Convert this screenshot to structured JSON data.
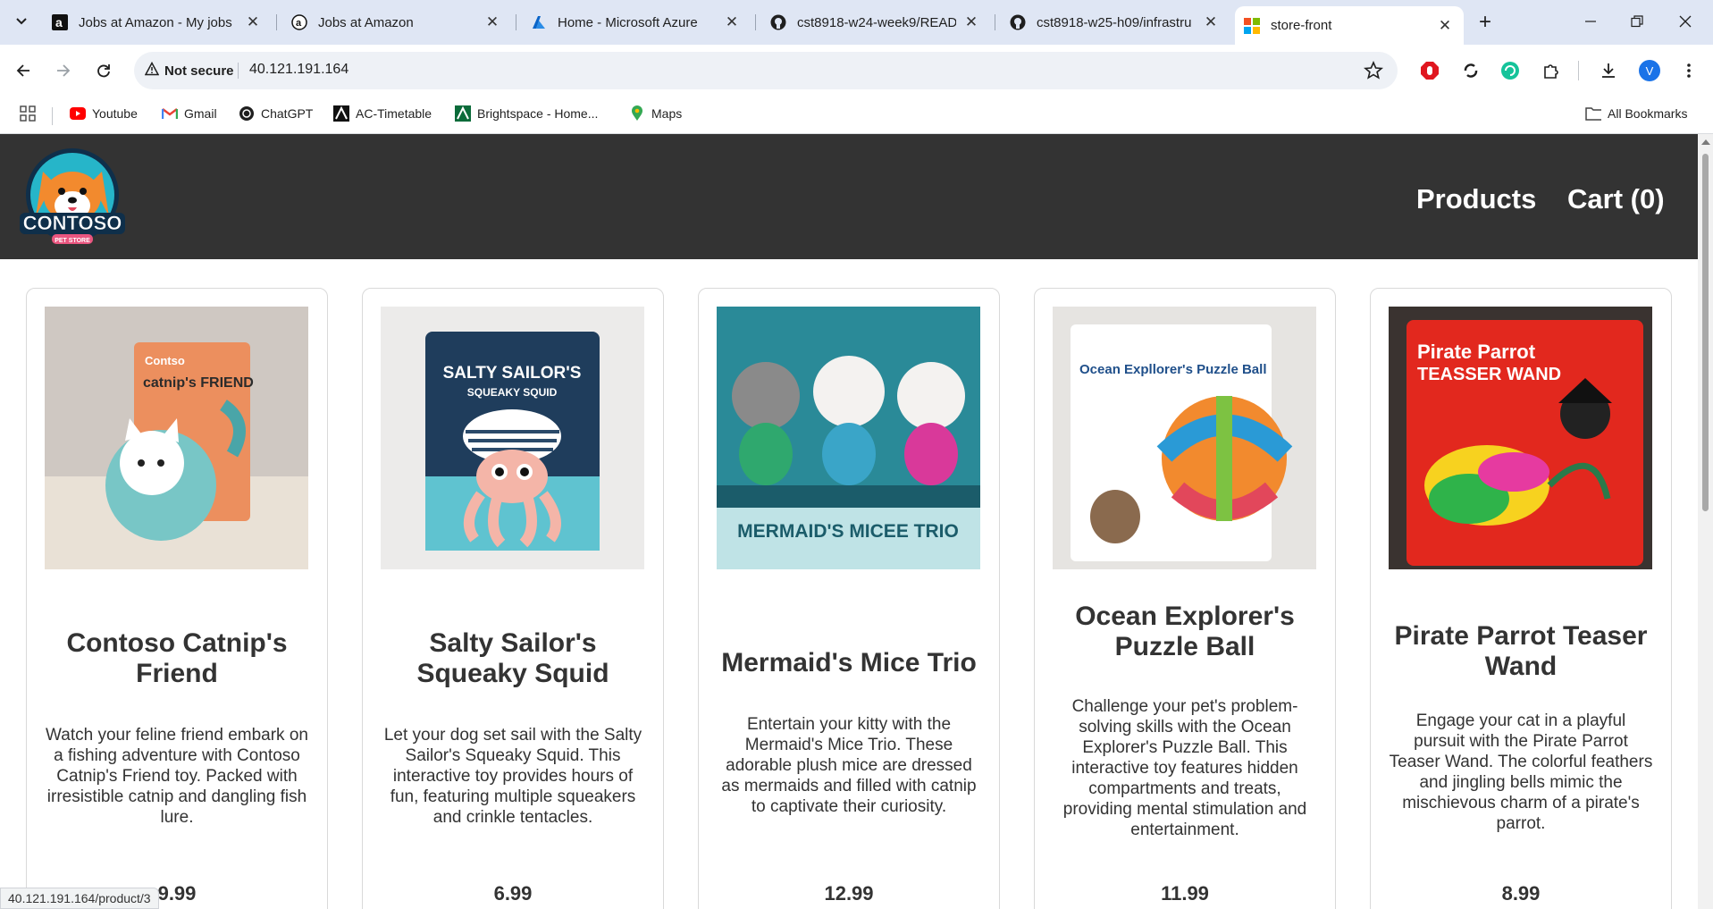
{
  "browser": {
    "tabs": [
      {
        "title": "Jobs at Amazon - My jobs",
        "icon": "amazon-icon"
      },
      {
        "title": "Jobs at Amazon",
        "icon": "amazon-jobs-icon"
      },
      {
        "title": "Home - Microsoft Azure",
        "icon": "azure-icon"
      },
      {
        "title": "cst8918-w24-week9/READ",
        "icon": "github-icon"
      },
      {
        "title": "cst8918-w25-h09/infrastru",
        "icon": "github-icon"
      },
      {
        "title": "store-front",
        "icon": "windows-logo-icon",
        "active": true
      }
    ],
    "security_label": "Not secure",
    "url": "40.121.191.164",
    "profile_initial": "V",
    "bookmarks": [
      {
        "label": "Youtube",
        "icon": "youtube-icon"
      },
      {
        "label": "Gmail",
        "icon": "gmail-icon"
      },
      {
        "label": "ChatGPT",
        "icon": "chatgpt-icon"
      },
      {
        "label": "AC-Timetable",
        "icon": "ac-icon"
      },
      {
        "label": "Brightspace - Home...",
        "icon": "brightspace-icon"
      },
      {
        "label": "Maps",
        "icon": "maps-pin-icon"
      }
    ],
    "all_bookmarks_label": "All Bookmarks",
    "status_url": "40.121.191.164/product/3"
  },
  "site": {
    "logo_text": "CONTOSO",
    "logo_subtext": "PET STORE",
    "nav": {
      "products": "Products",
      "cart": "Cart (0)"
    },
    "header_color": "#333333"
  },
  "products": [
    {
      "name": "Contoso Catnip's Friend",
      "description": "Watch your feline friend embark on a fishing adventure with Contoso Catnip's Friend toy. Packed with irresistible catnip and dangling fish lure.",
      "price": "9.99",
      "image": "catnip-friend-toy-image"
    },
    {
      "name": "Salty Sailor's Squeaky Squid",
      "description": "Let your dog set sail with the Salty Sailor's Squeaky Squid. This interactive toy provides hours of fun, featuring multiple squeakers and crinkle tentacles.",
      "price": "6.99",
      "image": "squeaky-squid-toy-image"
    },
    {
      "name": "Mermaid's Mice Trio",
      "description": "Entertain your kitty with the Mermaid's Mice Trio. These adorable plush mice are dressed as mermaids and filled with catnip to captivate their curiosity.",
      "price": "12.99",
      "image": "mermaid-mice-toy-image"
    },
    {
      "name": "Ocean Explorer's Puzzle Ball",
      "description": "Challenge your pet's problem-solving skills with the Ocean Explorer's Puzzle Ball. This interactive toy features hidden compartments and treats, providing mental stimulation and entertainment.",
      "price": "11.99",
      "image": "puzzle-ball-toy-image"
    },
    {
      "name": "Pirate Parrot Teaser Wand",
      "description": "Engage your cat in a playful pursuit with the Pirate Parrot Teaser Wand. The colorful feathers and jingling bells mimic the mischievous charm of a pirate's parrot.",
      "price": "8.99",
      "image": "teaser-wand-toy-image"
    }
  ],
  "product_image_text": {
    "p1_brand": "Contso",
    "p1_title": "catnip's FRIEND",
    "p2_title": "SALTY SAILOR'S",
    "p2_sub": "SQUEAKY SQUID",
    "p3_title": "MERMAID'S MICEE TRIO",
    "p4_title": "Ocean Expllorer's Puzzle Ball",
    "p5_title": "Pirate Parrot",
    "p5_sub": "TEASSER WAND"
  }
}
